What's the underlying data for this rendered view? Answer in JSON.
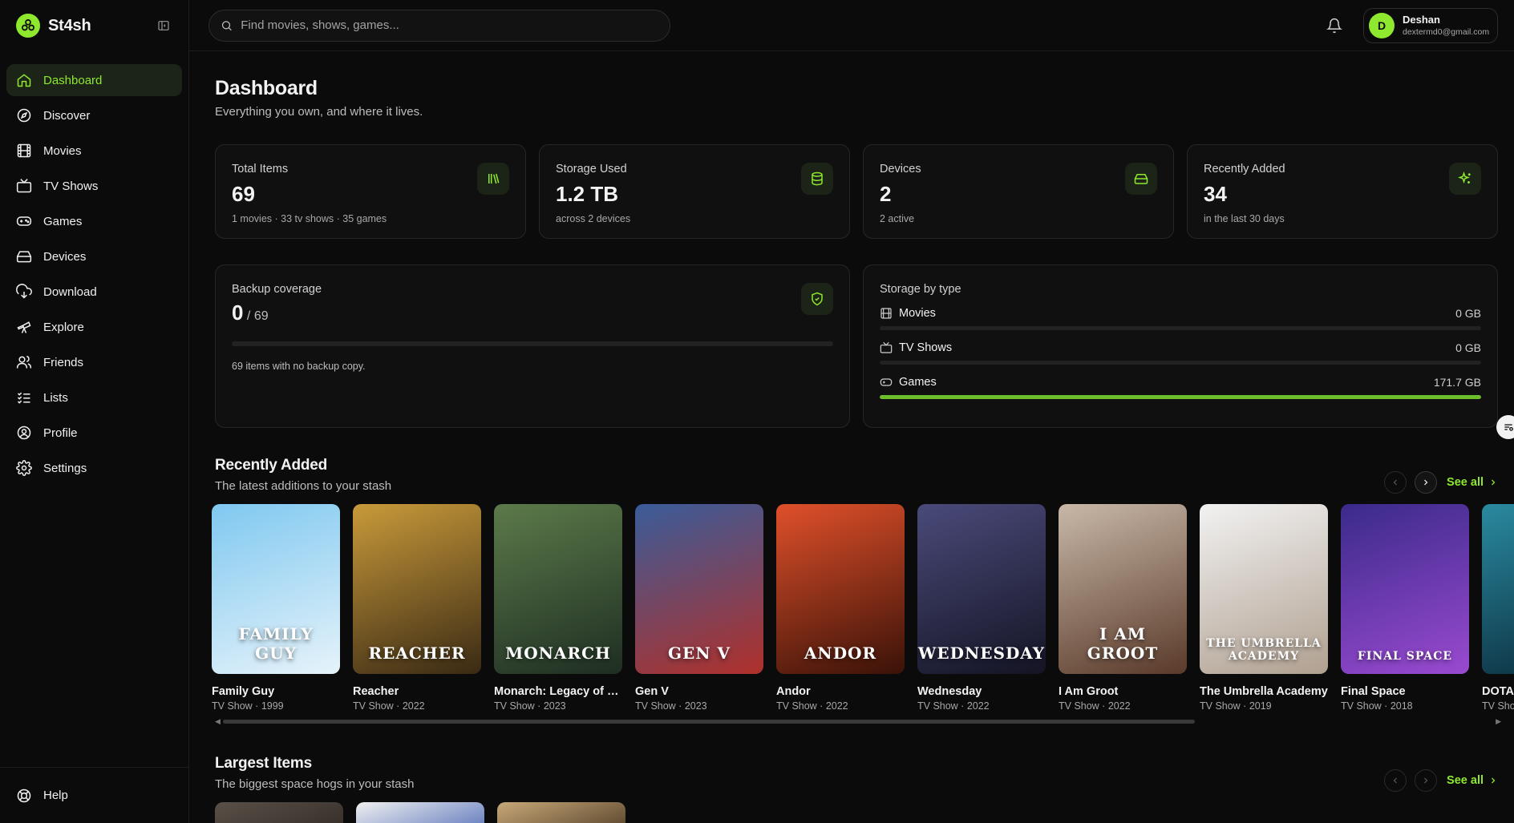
{
  "brand": {
    "name": "St4sh"
  },
  "nav": {
    "items": [
      {
        "label": "Dashboard",
        "icon": "home-icon",
        "active": true
      },
      {
        "label": "Discover",
        "icon": "compass-icon"
      },
      {
        "label": "Movies",
        "icon": "film-icon"
      },
      {
        "label": "TV Shows",
        "icon": "tv-icon"
      },
      {
        "label": "Games",
        "icon": "gamepad-icon"
      },
      {
        "label": "Devices",
        "icon": "hard-drive-icon"
      },
      {
        "label": "Download",
        "icon": "cloud-download-icon"
      },
      {
        "label": "Explore",
        "icon": "telescope-icon"
      },
      {
        "label": "Friends",
        "icon": "users-icon"
      },
      {
        "label": "Lists",
        "icon": "list-checks-icon"
      },
      {
        "label": "Profile",
        "icon": "user-circle-icon"
      },
      {
        "label": "Settings",
        "icon": "gear-icon"
      }
    ],
    "help_label": "Help"
  },
  "topbar": {
    "search_placeholder": "Find movies, shows, games...",
    "user": {
      "initial": "D",
      "name": "Deshan",
      "email": "dextermd0@gmail.com"
    }
  },
  "page": {
    "title": "Dashboard",
    "subtitle": "Everything you own, and where it lives."
  },
  "stats": [
    {
      "label": "Total Items",
      "value": "69",
      "sub": "1 movies · 33 tv shows · 35 games",
      "icon": "library-icon"
    },
    {
      "label": "Storage Used",
      "value": "1.2 TB",
      "sub": "across 2 devices",
      "icon": "database-icon"
    },
    {
      "label": "Devices",
      "value": "2",
      "sub": "2 active",
      "icon": "hard-drive-icon"
    },
    {
      "label": "Recently Added",
      "value": "34",
      "sub": "in the last 30 days",
      "icon": "sparkles-icon"
    }
  ],
  "backup": {
    "label": "Backup coverage",
    "value": "0",
    "total": "/ 69",
    "progress": 0,
    "note": "69 items with no backup copy.",
    "icon": "shield-check-icon"
  },
  "storage_by_type": {
    "title": "Storage by type",
    "rows": [
      {
        "label": "Movies",
        "value": "0 GB",
        "fraction": 0,
        "icon": "film-icon"
      },
      {
        "label": "TV Shows",
        "value": "0 GB",
        "fraction": 0,
        "icon": "tv-icon"
      },
      {
        "label": "Games",
        "value": "171.7 GB",
        "fraction": 1,
        "icon": "gamepad-icon"
      }
    ]
  },
  "recently_added": {
    "title": "Recently Added",
    "subtitle": "The latest additions to your stash",
    "see_all": "See all",
    "items": [
      {
        "title": "Family Guy",
        "meta": "TV Show · 1999",
        "poster_text": "FAMILY GUY",
        "colors": [
          "#7fc8f0",
          "#e6f3fa"
        ]
      },
      {
        "title": "Reacher",
        "meta": "TV Show · 2022",
        "poster_text": "REACHER",
        "colors": [
          "#c99a3a",
          "#3a2a14"
        ]
      },
      {
        "title": "Monarch: Legacy of Monsters",
        "meta": "TV Show · 2023",
        "poster_text": "MONARCH",
        "colors": [
          "#5c7a4a",
          "#1e2e22"
        ]
      },
      {
        "title": "Gen V",
        "meta": "TV Show · 2023",
        "poster_text": "GEN V",
        "colors": [
          "#3a5c9a",
          "#b0302a"
        ]
      },
      {
        "title": "Andor",
        "meta": "TV Show · 2022",
        "poster_text": "ANDOR",
        "colors": [
          "#e0502a",
          "#3a1208"
        ]
      },
      {
        "title": "Wednesday",
        "meta": "TV Show · 2022",
        "poster_text": "WEDNESDAY",
        "colors": [
          "#4a4a7a",
          "#141424"
        ]
      },
      {
        "title": "I Am Groot",
        "meta": "TV Show · 2022",
        "poster_text": "I AM GROOT",
        "colors": [
          "#c8b8a8",
          "#5a3a2a"
        ]
      },
      {
        "title": "The Umbrella Academy",
        "meta": "TV Show · 2019",
        "poster_text": "THE UMBRELLA ACADEMY",
        "colors": [
          "#f2f2f2",
          "#b0a090"
        ]
      },
      {
        "title": "Final Space",
        "meta": "TV Show · 2018",
        "poster_text": "FINAL SPACE",
        "colors": [
          "#3a2a8a",
          "#9a4ad0"
        ]
      },
      {
        "title": "DOTA",
        "meta": "TV Show",
        "poster_text": "",
        "colors": [
          "#2a8aa0",
          "#0a2a3a"
        ]
      }
    ]
  },
  "largest_items": {
    "title": "Largest Items",
    "subtitle": "The biggest space hogs in your stash",
    "see_all": "See all",
    "items": [
      {
        "colors": [
          "#5a5048",
          "#2a2420"
        ]
      },
      {
        "colors": [
          "#f0f0f0",
          "#3a5ab0"
        ]
      },
      {
        "colors": [
          "#c8a878",
          "#3a2a18"
        ]
      }
    ]
  },
  "colors": {
    "accent": "#8ee82e",
    "background": "#0b0b0b",
    "card": "#101010",
    "border": "#262626"
  }
}
